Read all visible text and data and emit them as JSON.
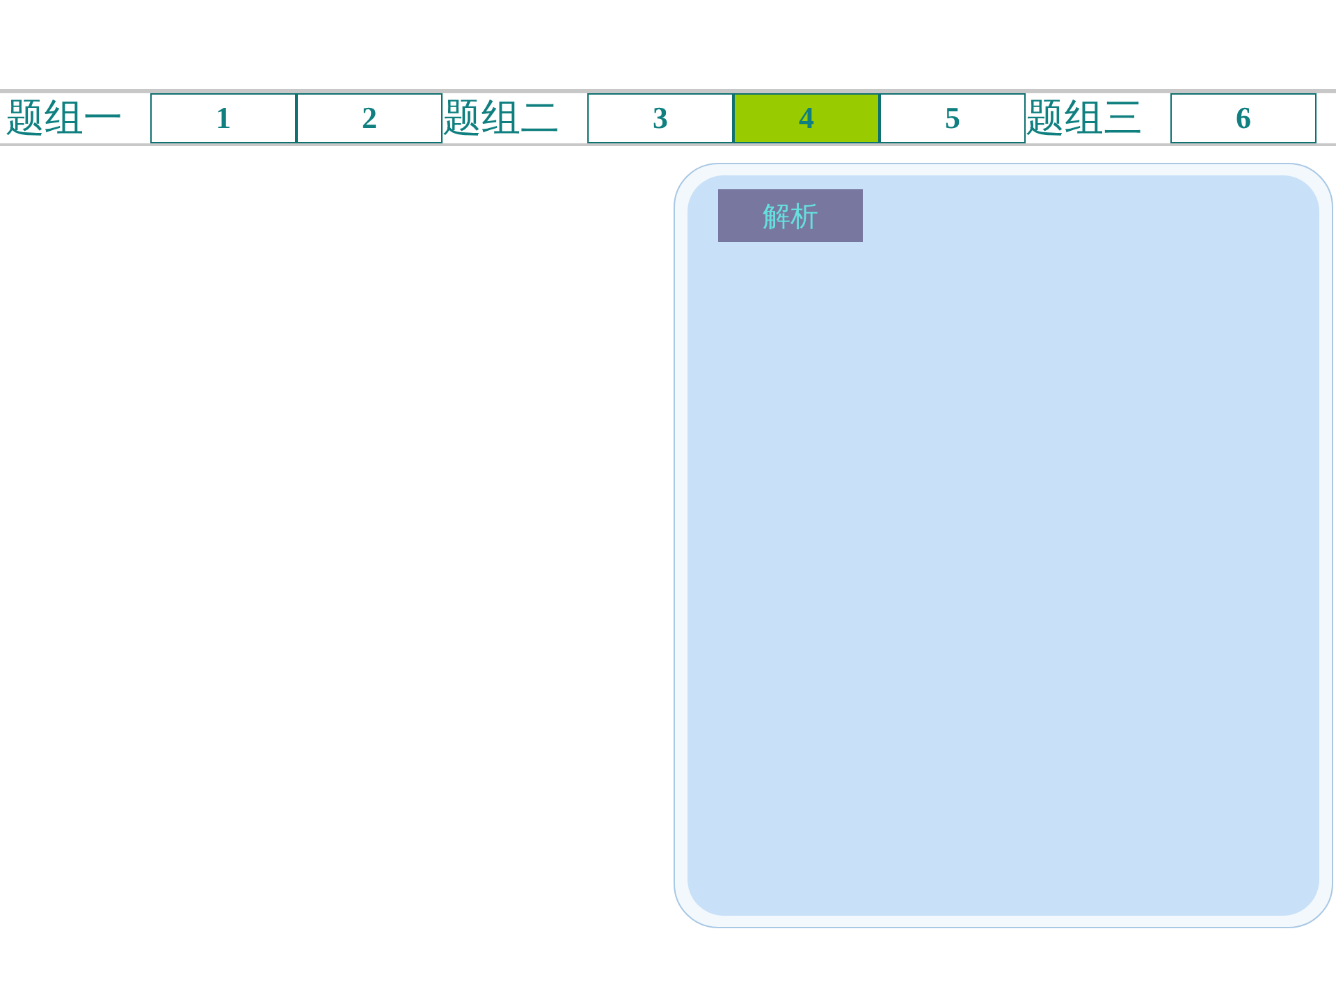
{
  "groups": [
    {
      "label": "题组一",
      "questions": [
        {
          "label": "1",
          "selected": false
        },
        {
          "label": "2",
          "selected": false
        }
      ]
    },
    {
      "label": "题组二",
      "questions": [
        {
          "label": "3",
          "selected": false
        },
        {
          "label": "4",
          "selected": true
        },
        {
          "label": "5",
          "selected": false
        }
      ]
    },
    {
      "label": "题组三",
      "questions": [
        {
          "label": "6",
          "selected": false
        }
      ]
    }
  ],
  "panel": {
    "button": "解析"
  }
}
